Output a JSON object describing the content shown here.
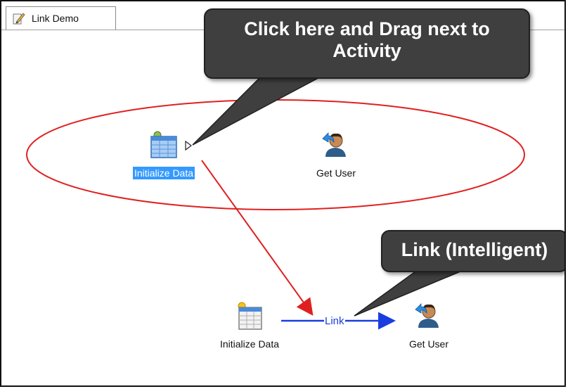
{
  "tab": {
    "title": "Link Demo",
    "icon": "pencil-document-icon"
  },
  "callouts": {
    "drag_hint_line1": "Click here and Drag next to",
    "drag_hint_line2": "Activity",
    "link_hint": "Link (Intelligent)"
  },
  "activities": {
    "top_initialize": {
      "label": "Initialize Data",
      "selected": true,
      "icon": "table-icon"
    },
    "top_get_user": {
      "label": "Get User",
      "icon": "user-icon"
    },
    "bottom_initialize": {
      "label": "Initialize Data",
      "icon": "table-icon"
    },
    "bottom_get_user": {
      "label": "Get User",
      "icon": "user-icon"
    }
  },
  "link": {
    "label": "Link"
  },
  "colors": {
    "selection": "#3399ff",
    "link": "#1a3de0",
    "annotation": "#e02020",
    "callout": "#3f3f3f"
  }
}
